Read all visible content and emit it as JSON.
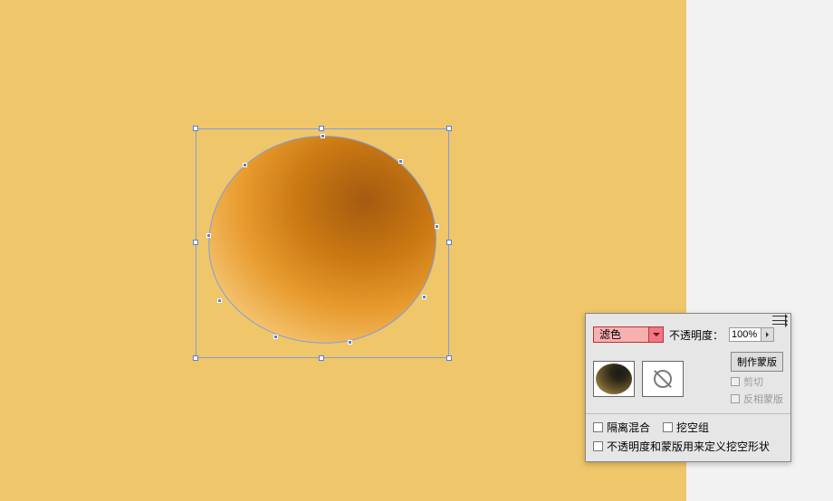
{
  "panel": {
    "blend_mode": "滤色",
    "opacity_label": "不透明度：",
    "opacity_value": "100%",
    "make_mask_btn": "制作蒙版",
    "clip_label": "剪切",
    "invert_mask_label": "反相蒙版",
    "isolate_blending_label": "隔离混合",
    "knockout_group_label": "挖空组",
    "use_opacity_mask_for_knockout_label": "不透明度和蒙版用来定义挖空形状"
  }
}
